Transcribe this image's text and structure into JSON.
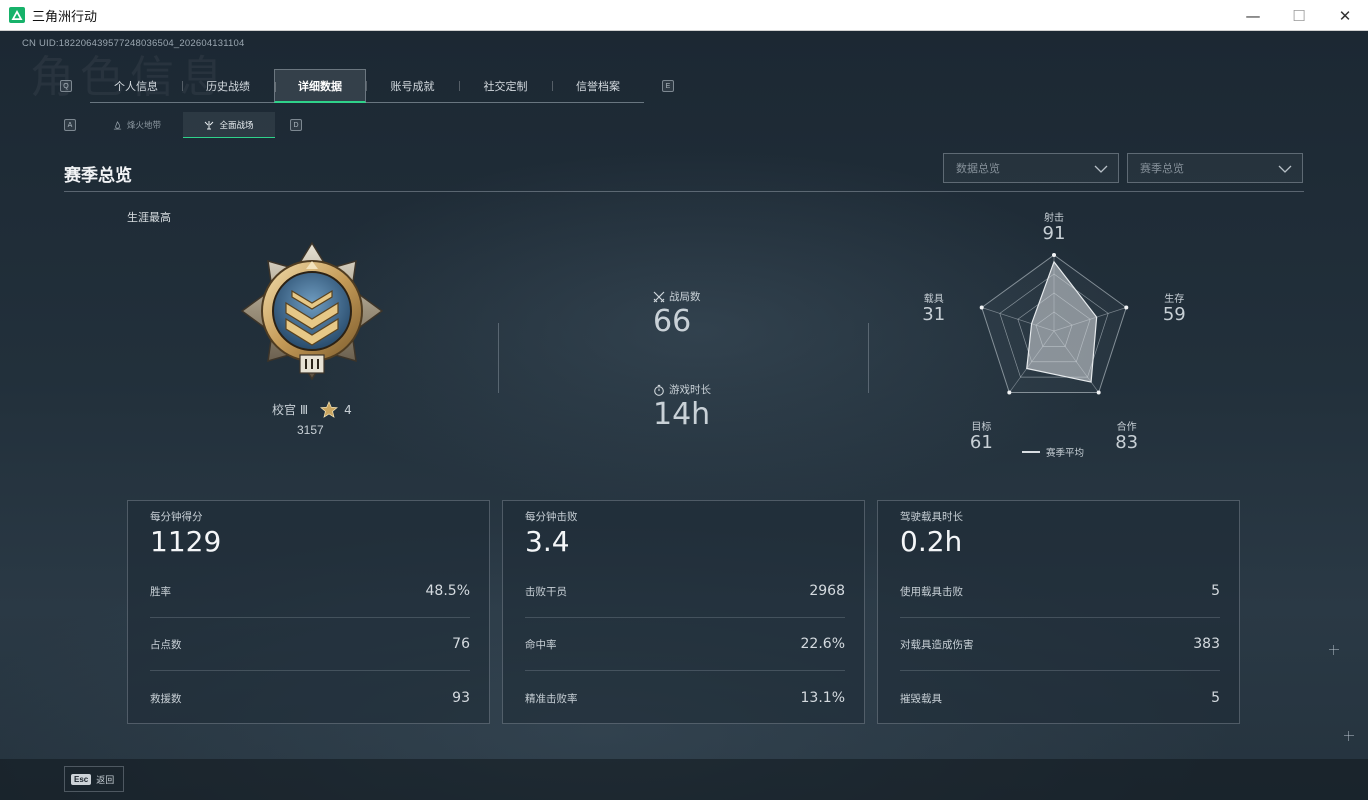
{
  "window": {
    "title": "三角洲行动",
    "controls": {
      "minimize": "—",
      "maximize": "☐",
      "close": "✕"
    }
  },
  "uid": "CN UID:1822064395772480365​04_202604131104",
  "watermark": "角色信息",
  "tabs": {
    "left_key": "Q",
    "right_key": "E",
    "items": [
      {
        "label": "个人信息",
        "active": false
      },
      {
        "label": "历史战绩",
        "active": false
      },
      {
        "label": "详细数据",
        "active": true
      },
      {
        "label": "账号成就",
        "active": false
      },
      {
        "label": "社交定制",
        "active": false
      },
      {
        "label": "信誉档案",
        "active": false
      }
    ]
  },
  "subtabs": {
    "left_key": "A",
    "right_key": "D",
    "items": [
      {
        "label": "烽火地带",
        "icon": "flame-icon",
        "active": false
      },
      {
        "label": "全面战场",
        "icon": "battlefield-icon",
        "active": true
      }
    ]
  },
  "section": {
    "title": "赛季总览",
    "dropdown_left": "数据总览",
    "dropdown_right": "赛季总览"
  },
  "career": {
    "label": "生涯最高",
    "rank_name": "校官 Ⅲ",
    "stars": "4",
    "score": "3157"
  },
  "summary": {
    "matches_label": "战局数",
    "matches_value": "66",
    "playtime_label": "游戏时长",
    "playtime_value": "14h"
  },
  "radar": {
    "axes": [
      {
        "label": "射击",
        "value": 91
      },
      {
        "label": "生存",
        "value": 59
      },
      {
        "label": "合作",
        "value": 83
      },
      {
        "label": "目标",
        "value": 61
      },
      {
        "label": "载具",
        "value": 31
      }
    ],
    "legend": "赛季平均",
    "fill_color": "#d9dde0"
  },
  "cards": [
    {
      "title": "每分钟得分",
      "main": "1129",
      "rows": [
        {
          "k": "胜率",
          "v": "48.5%"
        },
        {
          "k": "占点数",
          "v": "76"
        },
        {
          "k": "救援数",
          "v": "93"
        }
      ]
    },
    {
      "title": "每分钟击败",
      "main": "3.4",
      "rows": [
        {
          "k": "击败干员",
          "v": "2968"
        },
        {
          "k": "命中率",
          "v": "22.6%"
        },
        {
          "k": "精准击败率",
          "v": "13.1%"
        }
      ]
    },
    {
      "title": "驾驶载具时长",
      "main": "0.2h",
      "rows": [
        {
          "k": "使用载具击败",
          "v": "5"
        },
        {
          "k": "对载具造成伤害",
          "v": "383"
        },
        {
          "k": "摧毁载具",
          "v": "5"
        }
      ]
    }
  ],
  "footer": {
    "esc_key": "Esc",
    "back_label": "返回"
  },
  "colors": {
    "accent": "#2fd28a",
    "brand": "#17b26a"
  }
}
